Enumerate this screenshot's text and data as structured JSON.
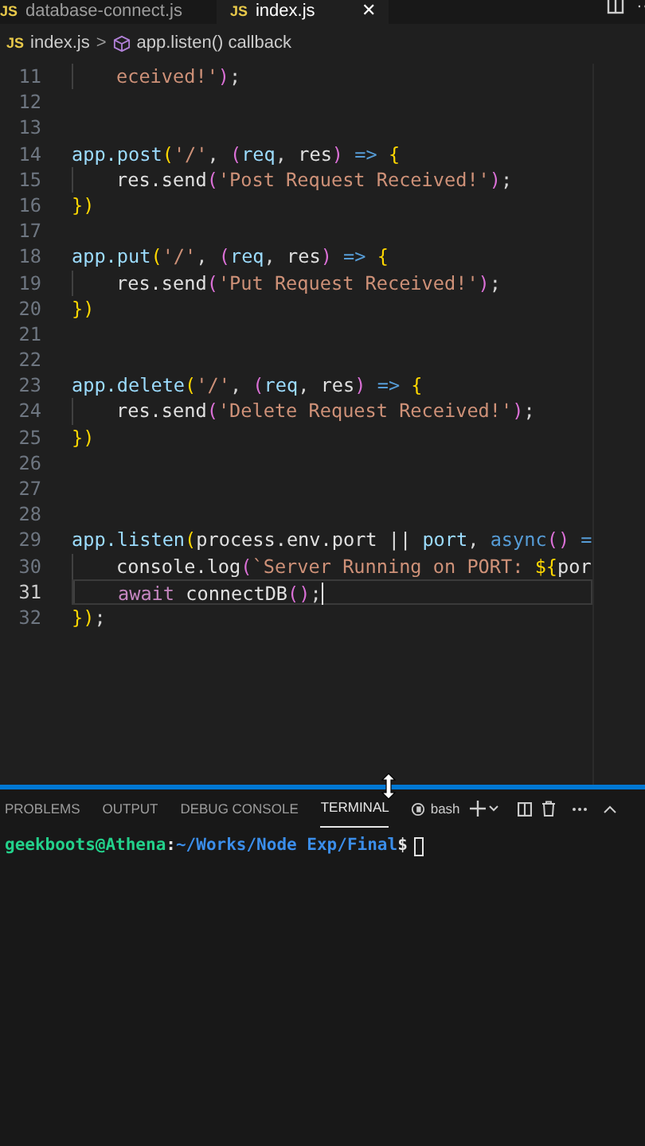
{
  "tabs": [
    {
      "icon": "JS",
      "label": "database-connect.js",
      "selected": false
    },
    {
      "icon": "JS",
      "label": "index.js",
      "selected": true,
      "close": "✕"
    }
  ],
  "editor_actions": {
    "more": "··"
  },
  "breadcrumb": {
    "file_icon": "JS",
    "file": "index.js",
    "separator": ">",
    "symbol": "app.listen() callback"
  },
  "code_lines": [
    {
      "number": "11",
      "indented": true,
      "tokens": [
        {
          "kind": "str",
          "text": "eceived!'"
        },
        {
          "kind": "paren",
          "text": ")"
        },
        {
          "kind": "punct",
          "text": ";"
        }
      ]
    },
    {
      "number": "12"
    },
    {
      "number": "13"
    },
    {
      "number": "14",
      "tokens": [
        {
          "kind": "var",
          "text": "app.post"
        },
        {
          "kind": "brace",
          "text": "("
        },
        {
          "kind": "str",
          "text": "'/'"
        },
        {
          "kind": "punct",
          "text": ", "
        },
        {
          "kind": "paren",
          "text": "("
        },
        {
          "kind": "var",
          "text": "req"
        },
        {
          "kind": "punct",
          "text": ", "
        },
        {
          "kind": "plain",
          "text": "res"
        },
        {
          "kind": "paren",
          "text": ")"
        },
        {
          "kind": "kw",
          "text": " => "
        },
        {
          "kind": "brace",
          "text": "{"
        }
      ]
    },
    {
      "number": "15",
      "indented": true,
      "tokens": [
        {
          "kind": "plain",
          "text": "res.send"
        },
        {
          "kind": "paren",
          "text": "("
        },
        {
          "kind": "str",
          "text": "'Post Request Received!'"
        },
        {
          "kind": "paren",
          "text": ")"
        },
        {
          "kind": "punct",
          "text": ";"
        }
      ]
    },
    {
      "number": "16",
      "tokens": [
        {
          "kind": "brace",
          "text": "})"
        }
      ]
    },
    {
      "number": "17"
    },
    {
      "number": "18",
      "tokens": [
        {
          "kind": "var",
          "text": "app.put"
        },
        {
          "kind": "brace",
          "text": "("
        },
        {
          "kind": "str",
          "text": "'/'"
        },
        {
          "kind": "punct",
          "text": ", "
        },
        {
          "kind": "paren",
          "text": "("
        },
        {
          "kind": "var",
          "text": "req"
        },
        {
          "kind": "punct",
          "text": ", "
        },
        {
          "kind": "plain",
          "text": "res"
        },
        {
          "kind": "paren",
          "text": ")"
        },
        {
          "kind": "kw",
          "text": " => "
        },
        {
          "kind": "brace",
          "text": "{"
        }
      ]
    },
    {
      "number": "19",
      "indented": true,
      "tokens": [
        {
          "kind": "plain",
          "text": "res.send"
        },
        {
          "kind": "paren",
          "text": "("
        },
        {
          "kind": "str",
          "text": "'Put Request Received!'"
        },
        {
          "kind": "paren",
          "text": ")"
        },
        {
          "kind": "punct",
          "text": ";"
        }
      ]
    },
    {
      "number": "20",
      "tokens": [
        {
          "kind": "brace",
          "text": "})"
        }
      ]
    },
    {
      "number": "21"
    },
    {
      "number": "22"
    },
    {
      "number": "23",
      "tokens": [
        {
          "kind": "var",
          "text": "app.delete"
        },
        {
          "kind": "brace",
          "text": "("
        },
        {
          "kind": "str",
          "text": "'/'"
        },
        {
          "kind": "punct",
          "text": ", "
        },
        {
          "kind": "paren",
          "text": "("
        },
        {
          "kind": "var",
          "text": "req"
        },
        {
          "kind": "punct",
          "text": ", "
        },
        {
          "kind": "plain",
          "text": "res"
        },
        {
          "kind": "paren",
          "text": ")"
        },
        {
          "kind": "kw",
          "text": " => "
        },
        {
          "kind": "brace",
          "text": "{"
        }
      ]
    },
    {
      "number": "24",
      "indented": true,
      "tokens": [
        {
          "kind": "plain",
          "text": "res.send"
        },
        {
          "kind": "paren",
          "text": "("
        },
        {
          "kind": "str",
          "text": "'Delete Request Received!'"
        },
        {
          "kind": "paren",
          "text": ")"
        },
        {
          "kind": "punct",
          "text": ";"
        }
      ]
    },
    {
      "number": "25",
      "tokens": [
        {
          "kind": "brace",
          "text": "})"
        }
      ]
    },
    {
      "number": "26"
    },
    {
      "number": "27"
    },
    {
      "number": "28"
    },
    {
      "number": "29",
      "tokens": [
        {
          "kind": "var",
          "text": "app.listen"
        },
        {
          "kind": "brace",
          "text": "("
        },
        {
          "kind": "plain",
          "text": "process.env.port || "
        },
        {
          "kind": "var",
          "text": "port"
        },
        {
          "kind": "punct",
          "text": ", "
        },
        {
          "kind": "kw",
          "text": "async"
        },
        {
          "kind": "paren",
          "text": "()"
        },
        {
          "kind": "kw",
          "text": " ="
        }
      ]
    },
    {
      "number": "30",
      "indented": true,
      "tokens": [
        {
          "kind": "plain",
          "text": "console.log"
        },
        {
          "kind": "paren",
          "text": "("
        },
        {
          "kind": "str",
          "text": "`Server Running on PORT: "
        },
        {
          "kind": "brace",
          "text": "${"
        },
        {
          "kind": "plain",
          "text": "por"
        }
      ]
    },
    {
      "number": "31",
      "indented": true,
      "current": true,
      "tokens": [
        {
          "kind": "kw2",
          "text": "await"
        },
        {
          "kind": "plain",
          "text": " connectDB"
        },
        {
          "kind": "paren",
          "text": "()"
        },
        {
          "kind": "punct",
          "text": ";"
        }
      ]
    },
    {
      "number": "32",
      "tokens": [
        {
          "kind": "brace",
          "text": "})"
        },
        {
          "kind": "punct",
          "text": ";"
        }
      ]
    }
  ],
  "panel_tabs": [
    {
      "label": "PROBLEMS",
      "selected": false
    },
    {
      "label": "OUTPUT",
      "selected": false
    },
    {
      "label": "DEBUG CONSOLE",
      "selected": false
    },
    {
      "label": "TERMINAL",
      "selected": true
    }
  ],
  "terminal_profile": "bash",
  "terminal": {
    "user": "geekboots@Athena",
    "colon": ":",
    "path": "~/Works/Node Exp/Final",
    "prompt": "$"
  }
}
